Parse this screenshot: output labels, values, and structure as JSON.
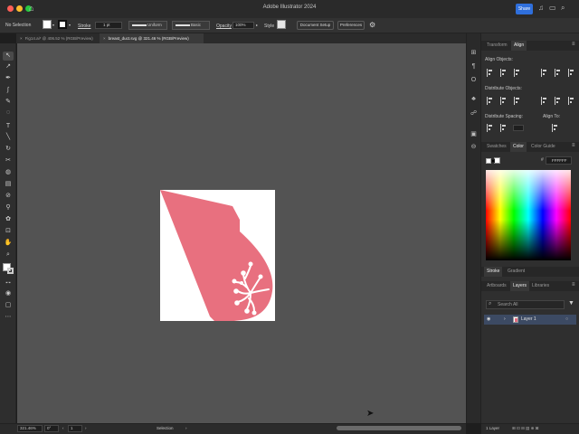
{
  "window": {
    "title": "Adobe Illustrator 2024",
    "share_label": "Share",
    "traffic_lights": [
      "#ff5f57",
      "#febc2e",
      "#28c840"
    ]
  },
  "control_bar": {
    "selection": "No Selection",
    "stroke_label": "Stroke",
    "stroke_weight": "1 pt",
    "profile_label": "Uniform",
    "brush_label": "Basic",
    "opacity_label": "Opacity",
    "opacity_value": "100%",
    "style_label": "Style",
    "doc_setup_label": "Document Setup",
    "prefs_label": "Preferences"
  },
  "tabs": [
    {
      "label": "Fig14.ai* @ 406.52 % (RGB/Preview)",
      "active": false
    },
    {
      "label": "breast_duct.svg @ 321.46 % (RGB/Preview)",
      "active": true
    }
  ],
  "status_bar": {
    "zoom": "321.46%",
    "rotation": "0°",
    "artboard": "1",
    "mode": "Selection"
  },
  "panels": {
    "top_tabs": [
      "Transform",
      "Align"
    ],
    "align_objects": "Align Objects:",
    "distribute_objects": "Distribute Objects:",
    "distribute_spacing": "Distribute Spacing:",
    "align_to": "Align To:",
    "color_tabs": [
      "Swatches",
      "Color",
      "Color Guide"
    ],
    "hex_value": "FFFFFF",
    "stroke_tabs": [
      "Stroke",
      "Gradient"
    ],
    "layer_tabs": [
      "Artboards",
      "Layers",
      "Libraries"
    ],
    "search_placeholder": "Search All",
    "layer_name": "Layer 1",
    "layer_count": "1 Layer"
  },
  "colors": {
    "shape_fill": "#e8707f",
    "accent": "#2f6fdc"
  }
}
